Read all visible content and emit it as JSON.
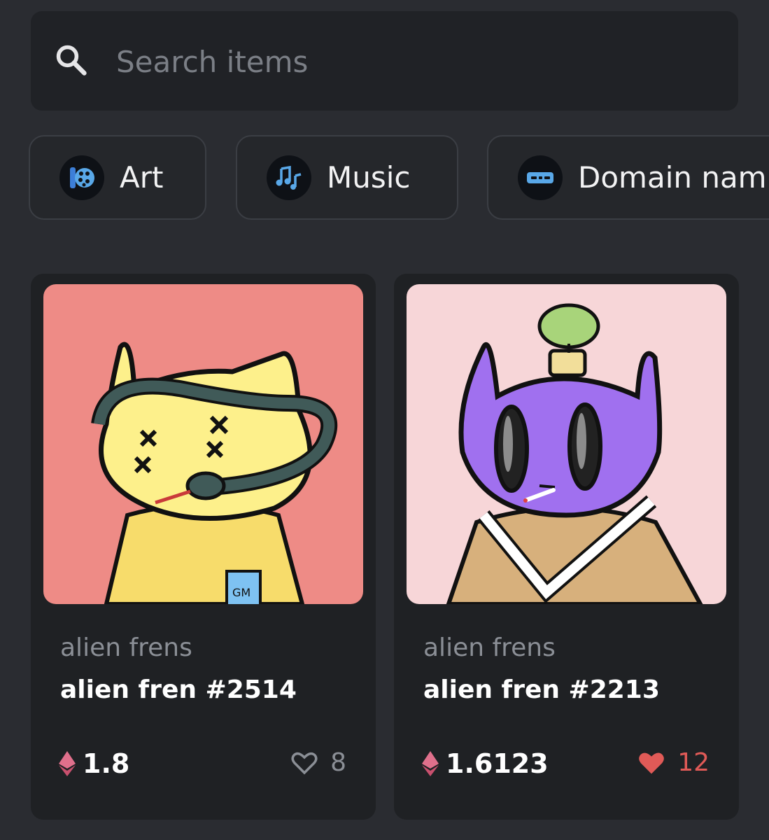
{
  "search": {
    "placeholder": "Search items"
  },
  "categories": [
    {
      "label": "Art",
      "icon": "palette-icon"
    },
    {
      "label": "Music",
      "icon": "music-notes-icon"
    },
    {
      "label": "Domain nam",
      "icon": "domain-icon"
    }
  ],
  "items": [
    {
      "collection": "alien frens",
      "name": "alien fren #2514",
      "price": "1.8",
      "likes": "8",
      "liked": false,
      "currency_icon": "ethereum-icon"
    },
    {
      "collection": "alien frens",
      "name": "alien fren #2213",
      "price": "1.6123",
      "likes": "12",
      "liked": true,
      "currency_icon": "ethereum-icon"
    }
  ],
  "colors": {
    "background": "#2a2c31",
    "card": "#1f2124",
    "liked": "#e05a57",
    "muted": "#8b8f96"
  }
}
